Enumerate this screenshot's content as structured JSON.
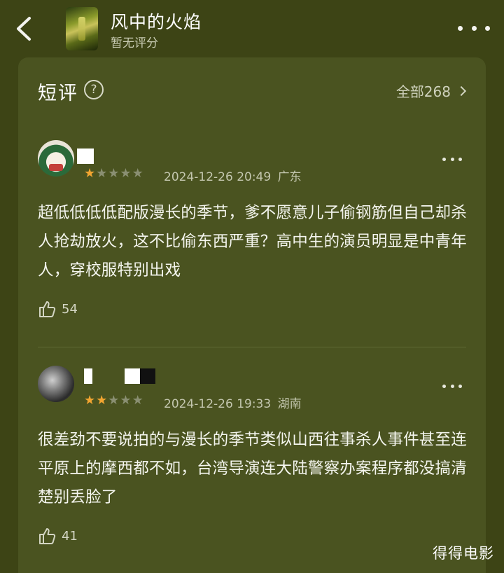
{
  "header": {
    "title": "风中的火焰",
    "rating_text": "暂无评分",
    "back_icon": "chevron-left-icon",
    "more_icon": "more-dots-icon"
  },
  "short_reviews": {
    "title": "短评",
    "help_icon": "question-circle-icon",
    "all_label": "全部268"
  },
  "reviews": [
    {
      "rating_stars": 1,
      "max_stars": 5,
      "date": "2024-12-26 20:49",
      "location": "广东",
      "content": "超低低低低配版漫长的季节，爹不愿意儿子偷钢筋但自己却杀人抢劫放火，这不比偷东西严重？高中生的演员明显是中青年人，穿校服特别出戏",
      "likes": "54"
    },
    {
      "rating_stars": 2,
      "max_stars": 5,
      "date": "2024-12-26 19:33",
      "location": "湖南",
      "content": "很差劲不要说拍的与漫长的季节类似山西往事杀人事件甚至连平原上的摩西都不如，台湾导演连大陆警察办案程序都没搞清楚别丢脸了",
      "likes": "41"
    }
  ],
  "watermark": "得得电影",
  "colors": {
    "background": "#3d4415",
    "card": "#4a5320",
    "star_on": "#f2a531",
    "star_off": "#8a8f72"
  }
}
